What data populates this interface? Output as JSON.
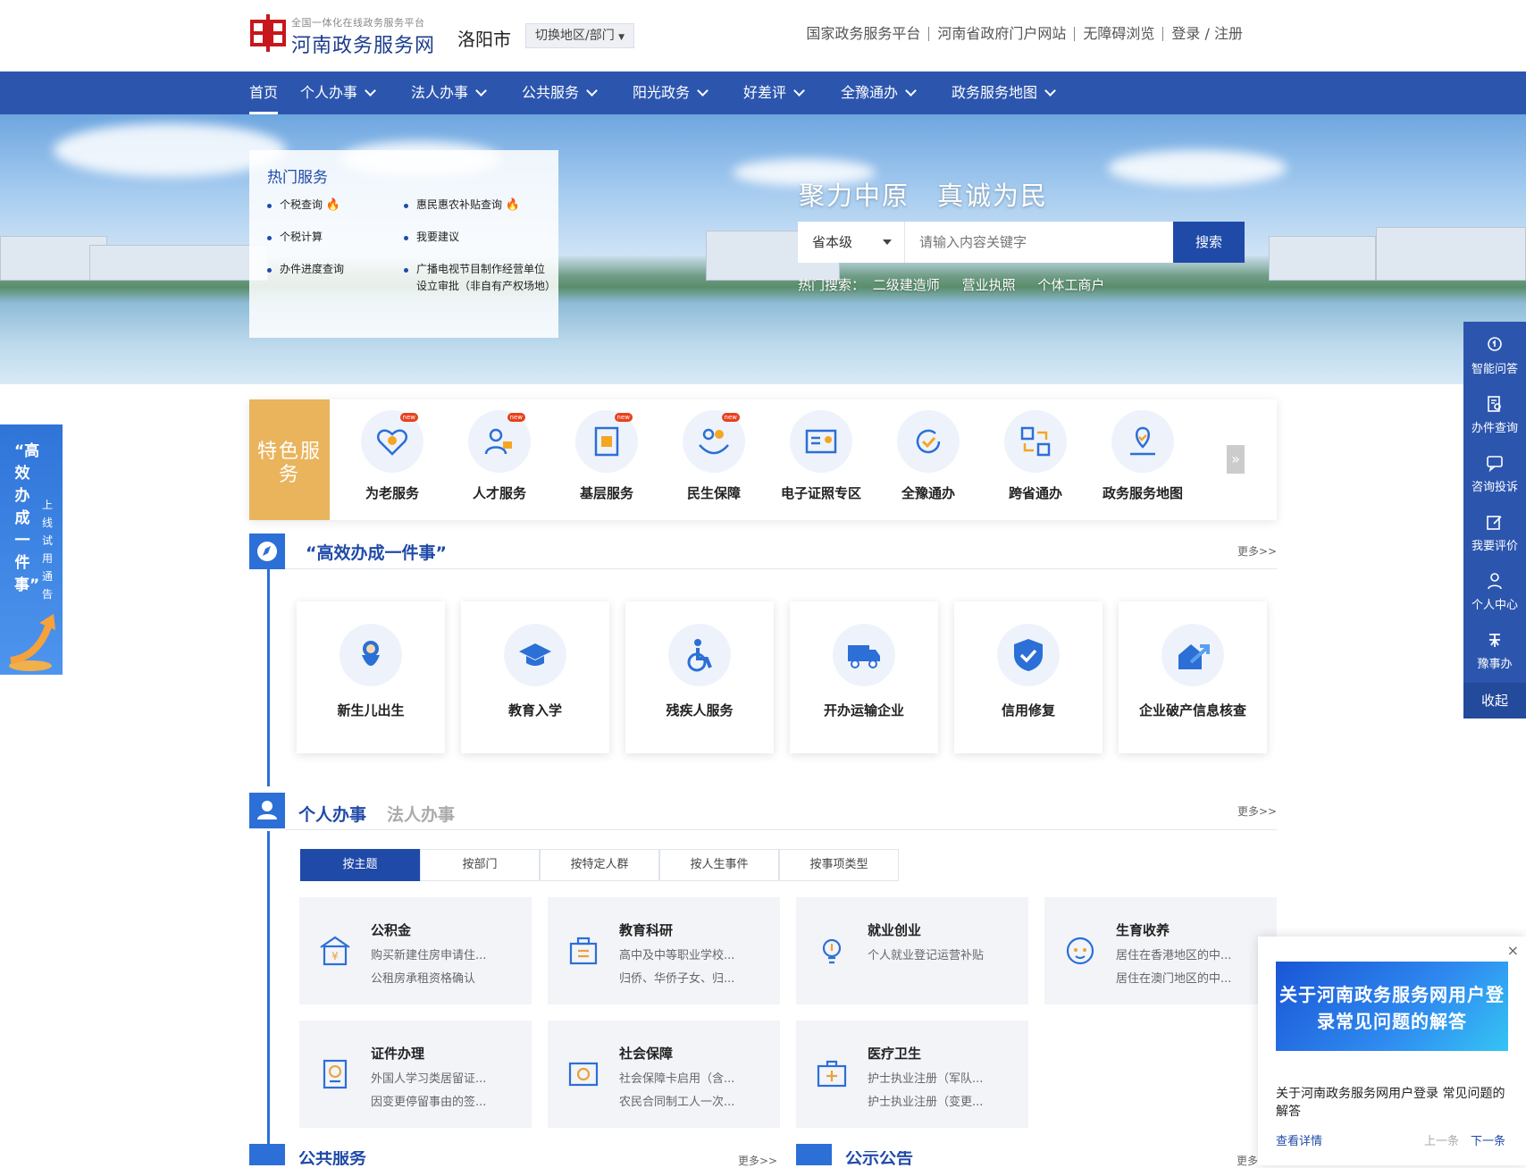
{
  "header": {
    "logo_sub": "全国一体化在线政务服务平台",
    "logo_title": "河南政务服务网",
    "city": "洛阳市",
    "switch_label": "切换地区/部门",
    "links": [
      "国家政务服务平台",
      "河南省政府门户网站",
      "无障碍浏览",
      "登录 / 注册"
    ]
  },
  "nav": {
    "items": [
      {
        "label": "首页"
      },
      {
        "label": "个人办事"
      },
      {
        "label": "法人办事"
      },
      {
        "label": "公共服务"
      },
      {
        "label": "阳光政务"
      },
      {
        "label": "好差评"
      },
      {
        "label": "全豫通办"
      },
      {
        "label": "政务服务地图"
      }
    ]
  },
  "hot_services": {
    "title": "热门服务",
    "items": [
      "个税查询",
      "惠民惠农补贴查询",
      "个税计算",
      "我要建议",
      "办件进度查询",
      "广播电视节目制作经营单位设立审批（非自有产权场地）"
    ]
  },
  "banner": {
    "slogan": "聚力中原　真诚为民",
    "level": "省本级",
    "placeholder": "请输入内容关键字",
    "search_btn": "搜索",
    "hot_label": "热门搜索：",
    "hot_terms": [
      "二级建造师",
      "营业执照",
      "个体工商户"
    ]
  },
  "right_sidebar": {
    "items": [
      "智能问答",
      "办件查询",
      "咨询投诉",
      "我要评价",
      "个人中心",
      "豫事办"
    ],
    "collapse": "收起"
  },
  "left_float": {
    "big": "“高效办成一件事”",
    "small": "上线试用通告"
  },
  "features": {
    "label": "特色服务",
    "items": [
      "为老服务",
      "人才服务",
      "基层服务",
      "民生保障",
      "电子证照专区",
      "全豫通办",
      "跨省通办",
      "政务服务地图"
    ],
    "new_badge": "new"
  },
  "efficient": {
    "title": "“高效办成一件事”",
    "more": "更多>>",
    "items": [
      "新生儿出生",
      "教育入学",
      "残疾人服务",
      "开办运输企业",
      "信用修复",
      "企业破产信息核查"
    ]
  },
  "affairs": {
    "tab_personal": "个人办事",
    "tab_legal": "法人办事",
    "more": "更多>>",
    "tabs": [
      "按主题",
      "按部门",
      "按特定人群",
      "按人生事件",
      "按事项类型"
    ],
    "cards": [
      {
        "title": "公积金",
        "l1": "购买新建住房申请住...",
        "l2": "公租房承租资格确认"
      },
      {
        "title": "教育科研",
        "l1": "高中及中等职业学校...",
        "l2": "归侨、华侨子女、归..."
      },
      {
        "title": "就业创业",
        "l1": "个人就业登记运营补贴",
        "l2": ""
      },
      {
        "title": "生育收养",
        "l1": "居住在香港地区的中...",
        "l2": "居住在澳门地区的中..."
      },
      {
        "title": "证件办理",
        "l1": "外国人学习类居留证...",
        "l2": "因变更停留事由的签..."
      },
      {
        "title": "社会保障",
        "l1": "社会保障卡启用（含...",
        "l2": "农民合同制工人一次..."
      },
      {
        "title": "医疗卫生",
        "l1": "护士执业注册（军队...",
        "l2": "护士执业注册（变更..."
      }
    ]
  },
  "bottom": {
    "public_service": "公共服务",
    "public_more": "更多>>",
    "notice": "公示公告",
    "notice_more": "更多"
  },
  "popup": {
    "close": "×",
    "img_text": "关于河南政务服务网用户登录常见问题的解答",
    "desc": "关于河南政务服务网用户登录 常见问题的解答",
    "detail": "查看详情",
    "prev": "上一条",
    "next": "下一条"
  },
  "colors": {
    "primary": "#2c56ae",
    "accent": "#1f4aa8",
    "gold": "#e9b45c",
    "hot": "#e8411e"
  }
}
